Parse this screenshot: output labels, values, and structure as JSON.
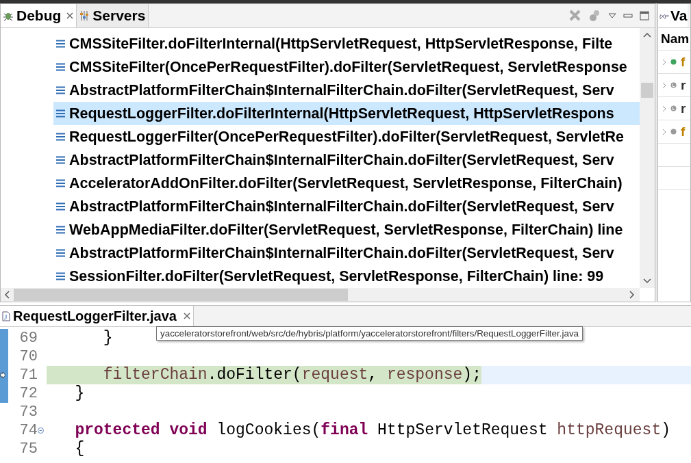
{
  "debug_view": {
    "tabs": [
      {
        "label": "Debug",
        "selected": true,
        "closable": true
      },
      {
        "label": "Servers",
        "selected": false,
        "closable": false
      }
    ],
    "stack_frames": [
      {
        "text": "CMSSiteFilter.doFilterInternal(HttpServletRequest, HttpServletResponse, Filte",
        "selected": false
      },
      {
        "text": "CMSSiteFilter(OncePerRequestFilter).doFilter(ServletRequest, ServletResponse",
        "selected": false
      },
      {
        "text": "AbstractPlatformFilterChain$InternalFilterChain.doFilter(ServletRequest, Serv",
        "selected": false
      },
      {
        "text": "RequestLoggerFilter.doFilterInternal(HttpServletRequest, HttpServletRespons",
        "selected": true
      },
      {
        "text": "RequestLoggerFilter(OncePerRequestFilter).doFilter(ServletRequest, ServletRe",
        "selected": false
      },
      {
        "text": "AbstractPlatformFilterChain$InternalFilterChain.doFilter(ServletRequest, Serv",
        "selected": false
      },
      {
        "text": "AcceleratorAddOnFilter.doFilter(ServletRequest, ServletResponse, FilterChain)",
        "selected": false
      },
      {
        "text": "AbstractPlatformFilterChain$InternalFilterChain.doFilter(ServletRequest, Serv",
        "selected": false
      },
      {
        "text": "WebAppMediaFilter.doFilter(ServletRequest, ServletResponse, FilterChain) line",
        "selected": false
      },
      {
        "text": "AbstractPlatformFilterChain$InternalFilterChain.doFilter(ServletRequest, Serv",
        "selected": false
      },
      {
        "text": "SessionFilter.doFilter(ServletRequest, ServletResponse, FilterChain) line: 99",
        "selected": false
      }
    ]
  },
  "variables_view": {
    "tab": {
      "icon": "(x)=",
      "label": "Va"
    },
    "header": "Nam",
    "rows": [
      {
        "name": "f",
        "color": "#3fa45f",
        "kind": "field"
      },
      {
        "name": "r",
        "color": "#9a9a9a",
        "kind": "local"
      },
      {
        "name": "r",
        "color": "#9a9a9a",
        "kind": "local"
      },
      {
        "name": "f",
        "color": "#9a9a9a",
        "kind": "field"
      }
    ]
  },
  "editor": {
    "tab": {
      "label": "RequestLoggerFilter.java"
    },
    "tooltip": "yacceleratorstorefront/web/src/de/hybris/platform/yacceleratorstorefront/filters/RequestLoggerFilter.java",
    "lines": [
      {
        "number": "69",
        "changed": true,
        "current": false,
        "foldable": false,
        "tokens": [
          {
            "kind": "plain",
            "text": "      }"
          }
        ]
      },
      {
        "number": "70",
        "changed": true,
        "current": false,
        "foldable": false
      },
      {
        "number": "71",
        "changed": true,
        "current": true,
        "foldable": false,
        "tokens": [
          {
            "kind": "variable",
            "text": "      filterChain"
          },
          {
            "kind": "plain",
            "text": ".doFilter("
          },
          {
            "kind": "variable",
            "text": "request"
          },
          {
            "kind": "plain",
            "text": ", "
          },
          {
            "kind": "variable",
            "text": "response"
          },
          {
            "kind": "plain",
            "text": ");"
          }
        ]
      },
      {
        "number": "72",
        "changed": true,
        "current": false,
        "foldable": false,
        "tokens": [
          {
            "kind": "plain",
            "text": "   }"
          }
        ]
      },
      {
        "number": "73",
        "changed": false,
        "current": false,
        "foldable": false
      },
      {
        "number": "74",
        "changed": false,
        "current": false,
        "foldable": true,
        "tokens": [
          {
            "kind": "keyword",
            "text": "   protected"
          },
          {
            "kind": "keyword",
            "text": " void"
          },
          {
            "kind": "plain",
            "text": " logCookies("
          },
          {
            "kind": "keyword",
            "text": "final"
          },
          {
            "kind": "plain",
            "text": " HttpServletRequest "
          },
          {
            "kind": "variable",
            "text": "httpRequest"
          },
          {
            "kind": "plain",
            "text": ")"
          }
        ]
      },
      {
        "number": "75",
        "changed": false,
        "current": false,
        "foldable": false,
        "tokens": [
          {
            "kind": "plain",
            "text": "   {"
          }
        ]
      }
    ]
  }
}
